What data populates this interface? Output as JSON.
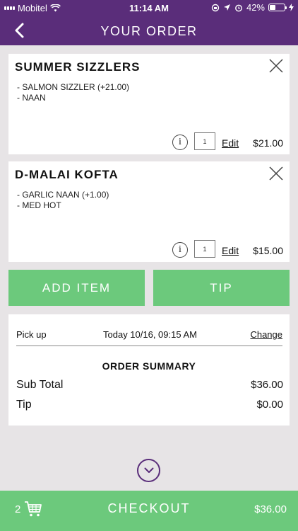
{
  "status_bar": {
    "carrier": "Mobitel",
    "time": "11:14 AM",
    "battery_percent": "42%",
    "battery_level": 0.42
  },
  "header": {
    "title": "YOUR ORDER"
  },
  "items": [
    {
      "name": "SUMMER SIZZLERS",
      "modifiers": [
        "- SALMON SIZZLER (+21.00)",
        "- NAAN"
      ],
      "quantity": "1",
      "edit_label": "Edit",
      "price": "$21.00"
    },
    {
      "name": "D-MALAI KOFTA",
      "modifiers": [
        "- GARLIC NAAN (+1.00)",
        "- MED HOT"
      ],
      "quantity": "1",
      "edit_label": "Edit",
      "price": "$15.00"
    }
  ],
  "actions": {
    "add_item_label": "ADD ITEM",
    "tip_label": "TIP"
  },
  "pickup": {
    "label": "Pick up",
    "time": "Today 10/16, 09:15 AM",
    "change_label": "Change"
  },
  "summary": {
    "heading": "ORDER SUMMARY",
    "rows": [
      {
        "label": "Sub Total",
        "value": "$36.00"
      },
      {
        "label": "Tip",
        "value": "$0.00"
      }
    ]
  },
  "checkout": {
    "item_count": "2",
    "label": "CHECKOUT",
    "total": "$36.00"
  },
  "icons": {
    "back": "chevron-left-icon",
    "remove": "close-icon",
    "info": "info-icon",
    "scroll": "chevron-down-icon",
    "cart": "cart-icon"
  },
  "colors": {
    "header": "#5a2d7a",
    "accent_green": "#6cc97c",
    "background": "#e7e4e6"
  }
}
